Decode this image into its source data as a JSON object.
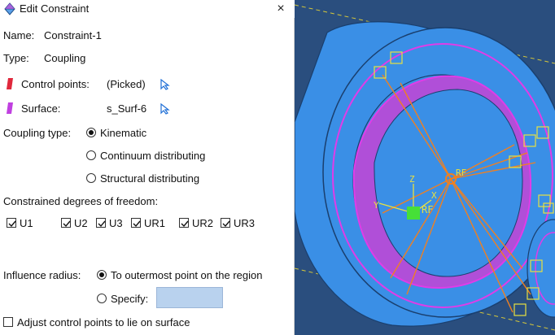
{
  "dialog": {
    "title": "Edit Constraint",
    "close_glyph": "×",
    "name_label": "Name:",
    "name_value": "Constraint-1",
    "type_label": "Type:",
    "type_value": "Coupling",
    "control_points_label": "Control points:",
    "control_points_value": "(Picked)",
    "surface_label": "Surface:",
    "surface_value": "s_Surf-6",
    "coupling_type_label": "Coupling type:",
    "coupling_options": [
      {
        "label": "Kinematic",
        "checked": true
      },
      {
        "label": "Continuum distributing",
        "checked": false
      },
      {
        "label": "Structural distributing",
        "checked": false
      }
    ],
    "dof_label": "Constrained degrees of freedom:",
    "dof": [
      {
        "label": "U1",
        "checked": true
      },
      {
        "label": "U2",
        "checked": true
      },
      {
        "label": "U3",
        "checked": true
      },
      {
        "label": "UR1",
        "checked": true
      },
      {
        "label": "UR2",
        "checked": true
      },
      {
        "label": "UR3",
        "checked": true
      }
    ],
    "influence_label": "Influence radius:",
    "influence_options": [
      {
        "label": "To outermost point on the region",
        "checked": true
      },
      {
        "label": "Specify:",
        "checked": false
      }
    ],
    "specify_value": "",
    "adjust_label": "Adjust control points to lie on surface",
    "adjust_checked": false
  },
  "viewport": {
    "axis_z": "Z",
    "axis_x": "X",
    "axis_y": "Y",
    "rf_label_1": "RF",
    "rf_label_2": "RF",
    "colors": {
      "background": "#2a4e7e",
      "part": "#3a8fe6",
      "surface": "#d04ae0",
      "constraint_lines": "#f08020",
      "markers": "#e8e040"
    }
  }
}
